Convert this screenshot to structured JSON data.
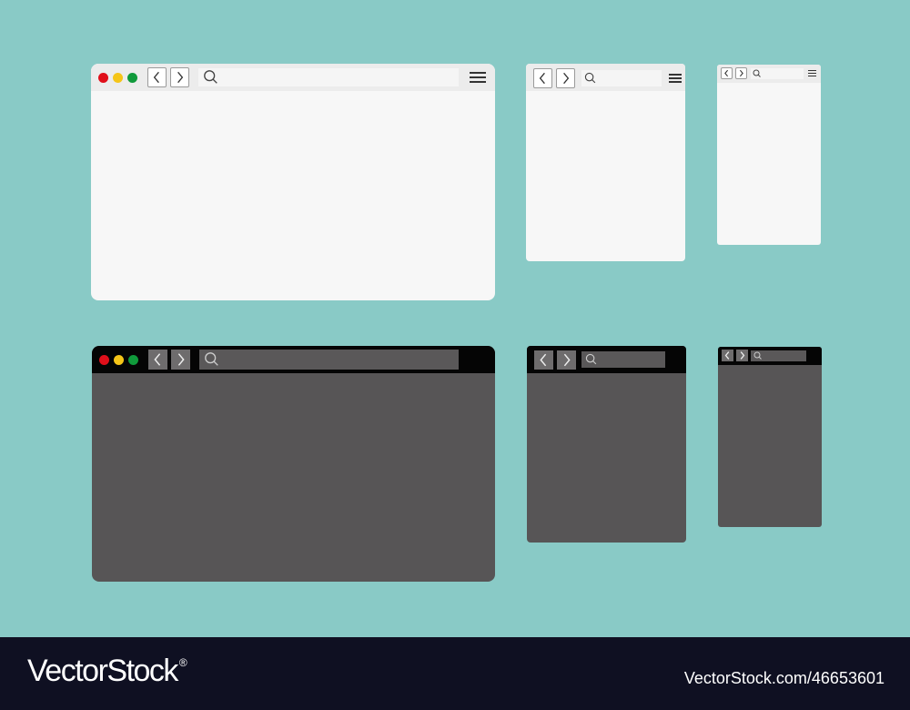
{
  "colors": {
    "background": "#89cac6",
    "light_content": "#f7f7f7",
    "light_toolbar": "#ececec",
    "dark_content": "#575556",
    "dark_toolbar": "#050505",
    "close_dot": "#e00f1a",
    "minimize_dot": "#f5c518",
    "maximize_dot": "#109a3b",
    "footer": "#0f1022"
  },
  "icons": [
    "back-chevron-icon",
    "forward-chevron-icon",
    "search-icon",
    "hamburger-menu-icon"
  ],
  "footer": {
    "logo": "VectorStock",
    "logo_mark": "®",
    "credit": "VectorStock.com/46653601"
  }
}
